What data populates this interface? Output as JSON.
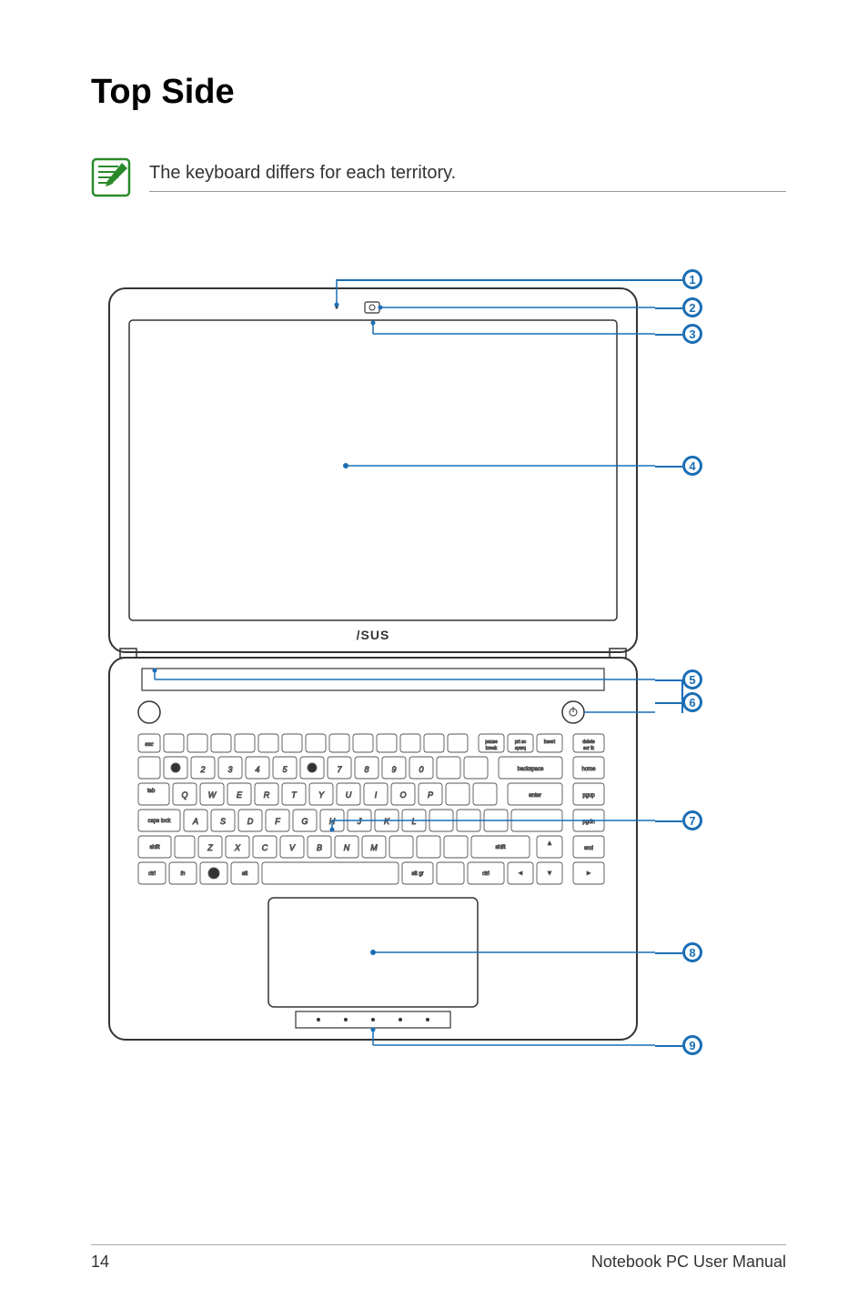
{
  "title": "Top Side",
  "note": "The keyboard differs for each territory.",
  "brand": "ASUS",
  "callouts": {
    "c1": "1",
    "c2": "2",
    "c3": "3",
    "c4": "4",
    "c5": "5",
    "c6": "6",
    "c7": "7",
    "c8": "8",
    "c9": "9"
  },
  "footer": {
    "page": "14",
    "manual": "Notebook PC User Manual"
  }
}
